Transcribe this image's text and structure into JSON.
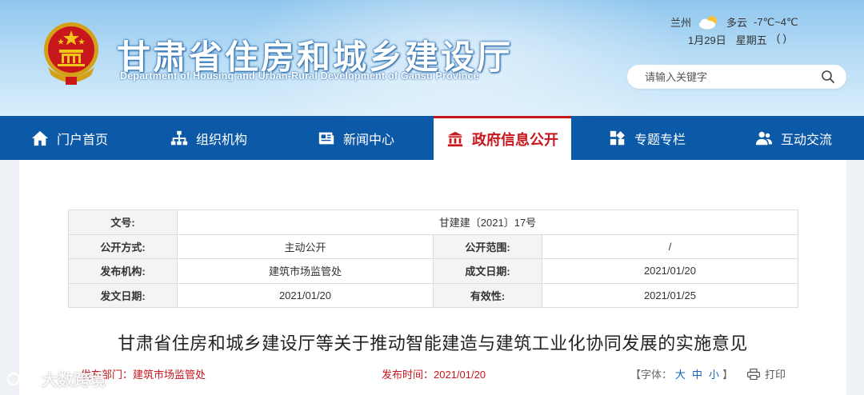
{
  "header": {
    "site_title": "甘肃省住房和城乡建设厅",
    "site_subtitle": "Department of Housing and Urban-Rural Development of Gansu Province",
    "weather": {
      "city": "兰州",
      "condition": "多云",
      "temperature": "-7℃~4℃",
      "icon": "cloudy-icon"
    },
    "date": {
      "day": "1月29日",
      "weekday": "星期五",
      "lunar": "(  )"
    },
    "search": {
      "placeholder": "请输入关键字",
      "icon": "search-icon"
    }
  },
  "nav": {
    "items": [
      {
        "label": "门户首页",
        "icon": "home-icon"
      },
      {
        "label": "组织机构",
        "icon": "org-chart-icon"
      },
      {
        "label": "新闻中心",
        "icon": "news-icon"
      },
      {
        "label": "政府信息公开",
        "icon": "government-building-icon",
        "active": true
      },
      {
        "label": "专题专栏",
        "icon": "grid-icon"
      },
      {
        "label": "互动交流",
        "icon": "users-icon"
      }
    ]
  },
  "meta": {
    "doc_no_label": "文号:",
    "doc_no": "甘建建〔2021〕17号",
    "disclosure_method_label": "公开方式:",
    "disclosure_method": "主动公开",
    "disclosure_scope_label": "公开范围:",
    "disclosure_scope": "/",
    "issuer_label": "发布机构:",
    "issuer": "建筑市场监管处",
    "created_date_label": "成文日期:",
    "created_date": "2021/01/20",
    "issue_date_label": "发文日期:",
    "issue_date": "2021/01/20",
    "effective_label": "有效性:",
    "effective": "2021/01/25"
  },
  "document": {
    "title": "甘肃省住房和城乡建设厅等关于推动智能建造与建筑工业化协同发展的实施意见",
    "dept_text": "发布部门：建筑市场监管处",
    "time_text": "发布时间：2021/01/20",
    "font_size_prefix": "【字体：",
    "font_large": "大",
    "font_medium": "中",
    "font_small": "小",
    "font_size_suffix": "】",
    "print_label": "打印"
  },
  "watermark": {
    "text": "大数跨境"
  }
}
